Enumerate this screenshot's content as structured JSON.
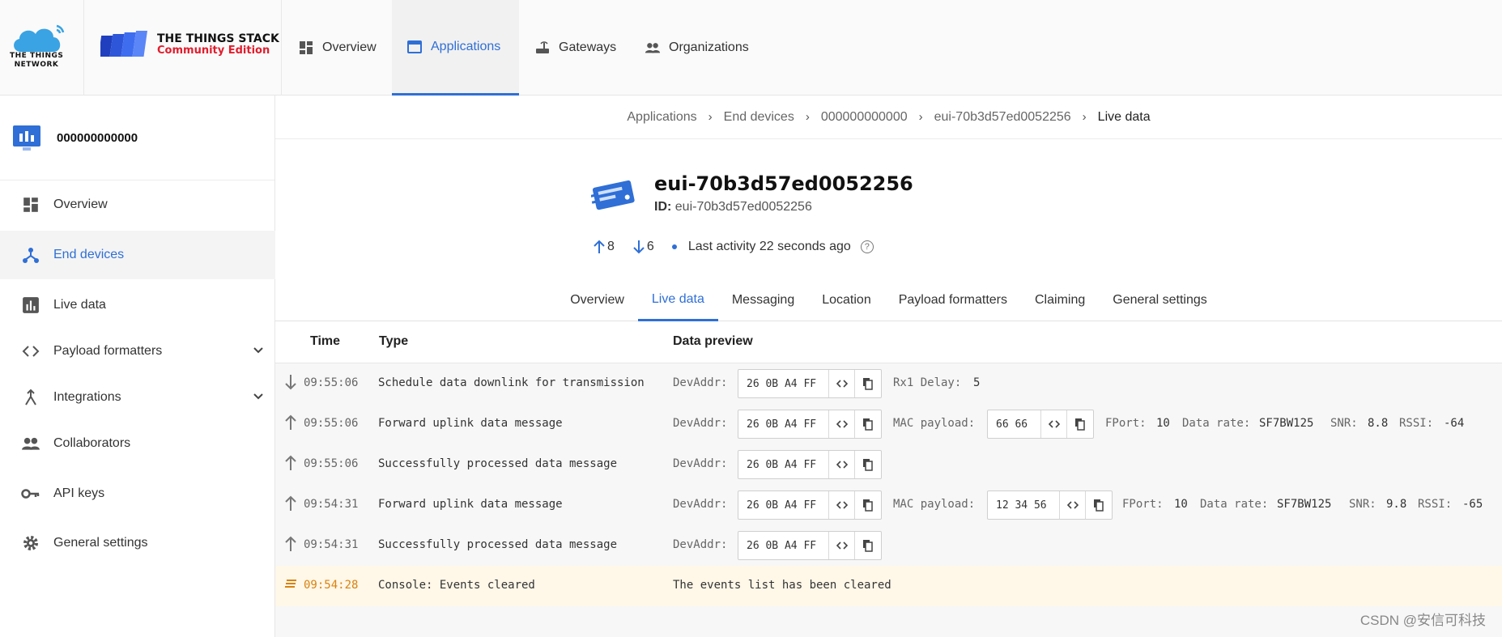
{
  "header": {
    "ttn_logo_text": "THE THINGS\nNETWORK",
    "stack_title": "THE THINGS STACK",
    "stack_subtitle": "Community Edition",
    "nav": [
      {
        "label": "Overview",
        "icon": "dashboard-icon",
        "active": false
      },
      {
        "label": "Applications",
        "icon": "window-icon",
        "active": true
      },
      {
        "label": "Gateways",
        "icon": "router-icon",
        "active": false
      },
      {
        "label": "Organizations",
        "icon": "people-icon",
        "active": false
      }
    ]
  },
  "sidebar": {
    "app_name": "000000000000",
    "items": [
      {
        "label": "Overview",
        "icon": "dashboard-icon",
        "active": false
      },
      {
        "label": "End devices",
        "icon": "device-hub-icon",
        "active": true
      },
      {
        "label": "Live data",
        "icon": "bar-chart-icon",
        "active": false
      },
      {
        "label": "Payload formatters",
        "icon": "code-icon",
        "active": false,
        "expandable": true
      },
      {
        "label": "Integrations",
        "icon": "merge-icon",
        "active": false,
        "expandable": true
      },
      {
        "label": "Collaborators",
        "icon": "people-icon",
        "active": false
      },
      {
        "label": "API keys",
        "icon": "key-icon",
        "active": false
      },
      {
        "label": "General settings",
        "icon": "gear-icon",
        "active": false
      }
    ]
  },
  "breadcrumbs": [
    "Applications",
    "End devices",
    "000000000000",
    "eui-70b3d57ed0052256",
    "Live data"
  ],
  "device": {
    "title": "eui-70b3d57ed0052256",
    "id_label": "ID:",
    "id_value": "eui-70b3d57ed0052256",
    "uplinks": "8",
    "downlinks": "6",
    "last_activity": "Last activity 22 seconds ago"
  },
  "tabs": [
    "Overview",
    "Live data",
    "Messaging",
    "Location",
    "Payload formatters",
    "Claiming",
    "General settings"
  ],
  "active_tab": "Live data",
  "events": {
    "columns": [
      "Time",
      "Type",
      "Data preview"
    ],
    "rows": [
      {
        "dir": "down",
        "time": "09:55:06",
        "type": "Schedule data downlink for transmission",
        "devaddr": "26 0B A4 FF",
        "extra": [
          {
            "label": "Rx1 Delay:",
            "value": "5"
          }
        ]
      },
      {
        "dir": "up",
        "time": "09:55:06",
        "type": "Forward uplink data message",
        "devaddr": "26 0B A4 FF",
        "mac_payload": "66 66",
        "extra": [
          {
            "label": "FPort:",
            "value": "10"
          },
          {
            "label": "Data rate:",
            "value": "SF7BW125"
          },
          {
            "label": "SNR:",
            "value": "8.8"
          },
          {
            "label": "RSSI:",
            "value": "-64"
          }
        ]
      },
      {
        "dir": "up",
        "time": "09:55:06",
        "type": "Successfully processed data message",
        "devaddr": "26 0B A4 FF"
      },
      {
        "dir": "up",
        "time": "09:54:31",
        "type": "Forward uplink data message",
        "devaddr": "26 0B A4 FF",
        "mac_payload": "12 34 56",
        "extra": [
          {
            "label": "FPort:",
            "value": "10"
          },
          {
            "label": "Data rate:",
            "value": "SF7BW125"
          },
          {
            "label": "SNR:",
            "value": "9.8"
          },
          {
            "label": "RSSI:",
            "value": "-65"
          }
        ]
      },
      {
        "dir": "up",
        "time": "09:54:31",
        "type": "Successfully processed data message",
        "devaddr": "26 0B A4 FF"
      },
      {
        "dir": "info",
        "time": "09:54:28",
        "type": "Console: Events cleared",
        "message": "The events list has been cleared"
      }
    ],
    "devaddr_label": "DevAddr:",
    "mac_payload_label": "MAC payload:"
  },
  "watermark": "CSDN @安信可科技",
  "colors": {
    "accent": "#2f6fd6",
    "brand_red": "#e11d2d",
    "info_bg": "#fff7e8"
  }
}
